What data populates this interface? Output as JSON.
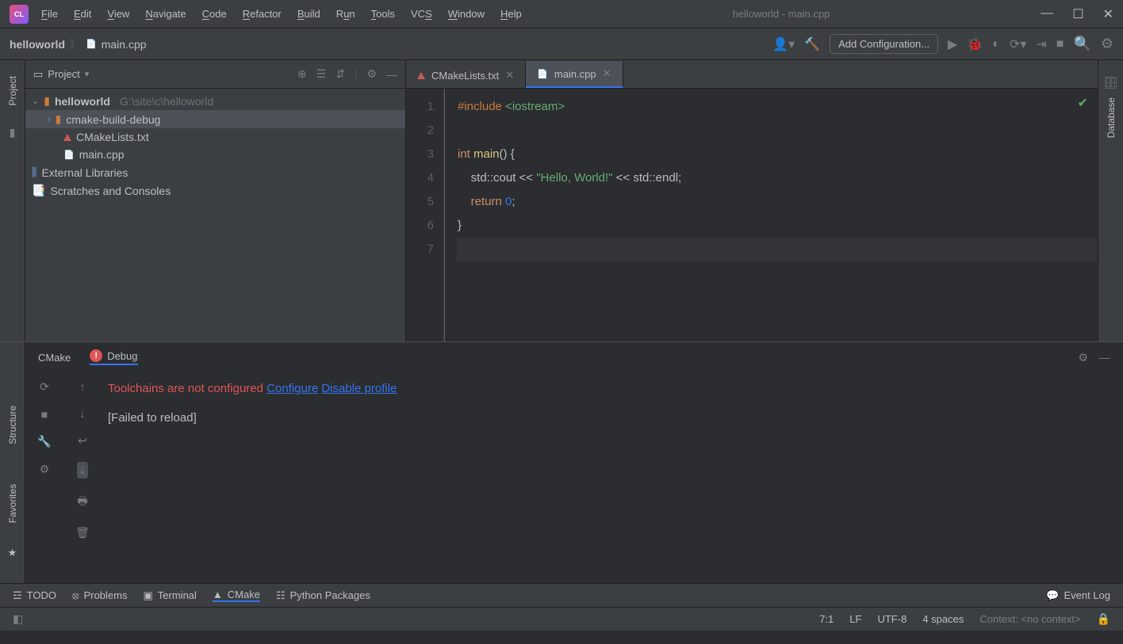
{
  "title": "helloworld - main.cpp",
  "menu": [
    "File",
    "Edit",
    "View",
    "Navigate",
    "Code",
    "Refactor",
    "Build",
    "Run",
    "Tools",
    "VCS",
    "Window",
    "Help"
  ],
  "breadcrumb": {
    "project": "helloworld",
    "file": "main.cpp"
  },
  "navbar": {
    "add_config": "Add Configuration..."
  },
  "left_rail": {
    "project": "Project"
  },
  "panel": {
    "title": "Project"
  },
  "tree": {
    "root": "helloworld",
    "root_path": "G:\\site\\c\\helloworld",
    "cmake_build": "cmake-build-debug",
    "cmakelists": "CMakeLists.txt",
    "maincpp": "main.cpp",
    "extlib": "External Libraries",
    "scratches": "Scratches and Consoles"
  },
  "tabs": {
    "cmake": "CMakeLists.txt",
    "main": "main.cpp"
  },
  "code": {
    "l1a": "#include",
    "l1b": " <iostream>",
    "l3a": "int",
    "l3b": " main",
    "l3c": "() {",
    "l4a": "    std::cout << ",
    "l4b": "\"Hello, World!\"",
    "l4c": " << std::endl;",
    "l5a": "    ",
    "l5b": "return",
    "l5c": " ",
    "l5d": "0",
    "l5e": ";",
    "l6": "}"
  },
  "right_rail": {
    "database": "Database"
  },
  "bottom_tabs": {
    "cmake": "CMake",
    "debug": "Debug"
  },
  "console": {
    "err": "Toolchains are not configured ",
    "conf": "Configure",
    "disable": "Disable profile",
    "fail": "[Failed to reload]"
  },
  "bottom_bar": {
    "todo": "TODO",
    "problems": "Problems",
    "terminal": "Terminal",
    "cmake": "CMake",
    "python": "Python Packages",
    "eventlog": "Event Log"
  },
  "status": {
    "pos": "7:1",
    "lf": "LF",
    "enc": "UTF-8",
    "indent": "4 spaces",
    "context": "Context: <no context>"
  },
  "left_rail2": {
    "structure": "Structure",
    "favorites": "Favorites"
  }
}
